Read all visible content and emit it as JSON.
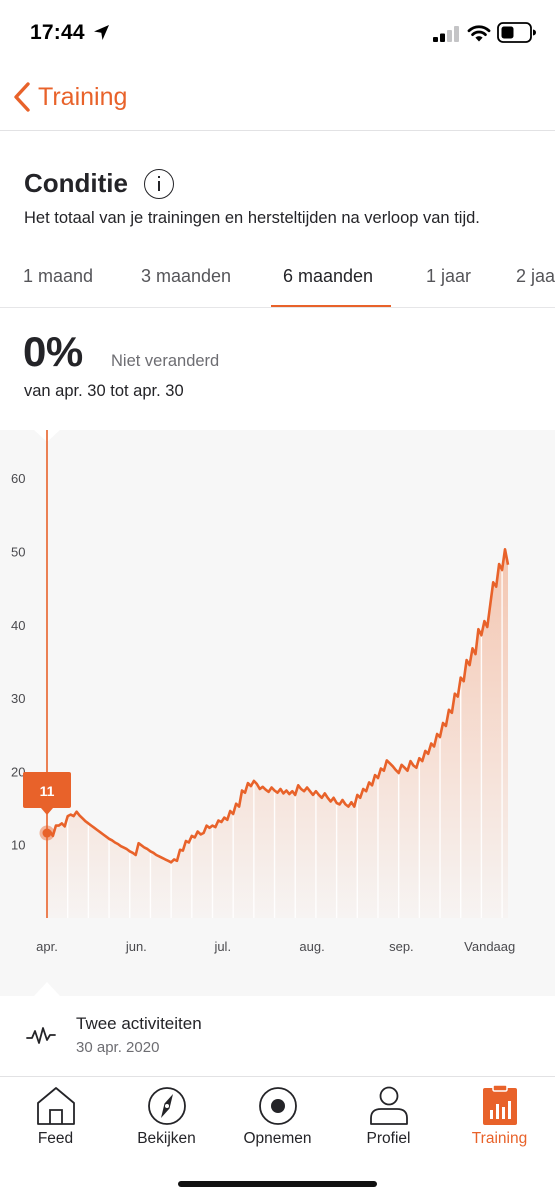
{
  "status_bar": {
    "time": "17:44"
  },
  "nav": {
    "back_label": "Training"
  },
  "header": {
    "title": "Conditie",
    "subtitle": "Het totaal van je trainingen en hersteltijden na verloop van tijd."
  },
  "tabs": [
    {
      "label": "1 maand",
      "active": false
    },
    {
      "label": "3 maanden",
      "active": false
    },
    {
      "label": "6 maanden",
      "active": true
    },
    {
      "label": "1 jaar",
      "active": false
    },
    {
      "label": "2 jaar",
      "active": false
    }
  ],
  "summary": {
    "value": "0%",
    "change": "Niet veranderd",
    "range": "van apr. 30 tot apr. 30"
  },
  "colors": {
    "accent": "#e8622a",
    "text": "#242428",
    "muted": "#6d6d72"
  },
  "chart_data": {
    "type": "area",
    "ylim": [
      0,
      65
    ],
    "y_ticks": [
      10,
      20,
      30,
      40,
      50,
      60
    ],
    "x_tick_labels": [
      "apr.",
      "jun.",
      "jul.",
      "aug.",
      "sep.",
      "Vandaag"
    ],
    "x_tick_positions": [
      0,
      31,
      61,
      92,
      123,
      154
    ],
    "selected_index": 0,
    "selected_label": "11",
    "series": [
      {
        "values": [
          12,
          11.8,
          11.2,
          12.6,
          12.6,
          12.9,
          12.5,
          13.9,
          14.1,
          13.9,
          14.5,
          14,
          13.6,
          13.2,
          12.9,
          12.6,
          12.3,
          12,
          11.7,
          11.4,
          11.1,
          10.8,
          10.6,
          10.3,
          10.1,
          9.8,
          9.6,
          9.4,
          9.1,
          8.9,
          8.6,
          10.2,
          9.9,
          9.6,
          9.4,
          9.1,
          8.9,
          8.6,
          8.4,
          8.2,
          8,
          7.8,
          7.6,
          8,
          7.8,
          9.3,
          9.2,
          10.5,
          10.3,
          11.2,
          11,
          11.8,
          11.4,
          11.6,
          12.6,
          12.3,
          12.6,
          12.4,
          13.3,
          13.1,
          13.7,
          13.4,
          14.6,
          14.2,
          15.6,
          15.2,
          17.4,
          17.1,
          18.4,
          18,
          18.7,
          18.3,
          17.6,
          17.9,
          17.5,
          17.2,
          17.8,
          17.4,
          17.1,
          17.6,
          17,
          17.4,
          16.9,
          17.3,
          16.8,
          18.1,
          17.6,
          17.3,
          17.8,
          17.3,
          16.8,
          17.3,
          16.8,
          16.4,
          17,
          16.4,
          15.9,
          16.4,
          15.7,
          15.5,
          16.1,
          15.5,
          15.2,
          15.8,
          15.2,
          16.8,
          16.4,
          17.6,
          17.3,
          18.5,
          18.1,
          19.5,
          19.1,
          20.4,
          20.1,
          21.5,
          21.1,
          20.7,
          20.2,
          19.8,
          20.9,
          20.5,
          20.1,
          21.4,
          20.8,
          20.5,
          21.8,
          21.4,
          22.8,
          22.4,
          23.8,
          23.4,
          25.1,
          24.7,
          26.6,
          26.2,
          28.4,
          28,
          30.6,
          30.2,
          32.8,
          32.3,
          35.2,
          34.5,
          36.8,
          36,
          39.4,
          38.6,
          40.5,
          39.7,
          42.8,
          45.8,
          45.2,
          48.3,
          47.5,
          50.3,
          48.2
        ],
        "x_start_date": "2020-04-30"
      }
    ]
  },
  "activity": {
    "title": "Twee activiteiten",
    "date": "30 apr. 2020"
  },
  "tabbar": [
    {
      "label": "Feed",
      "icon": "home-icon",
      "active": false
    },
    {
      "label": "Bekijken",
      "icon": "compass-icon",
      "active": false
    },
    {
      "label": "Opnemen",
      "icon": "record-icon",
      "active": false
    },
    {
      "label": "Profiel",
      "icon": "person-icon",
      "active": false
    },
    {
      "label": "Training",
      "icon": "training-chart-icon",
      "active": true
    }
  ]
}
